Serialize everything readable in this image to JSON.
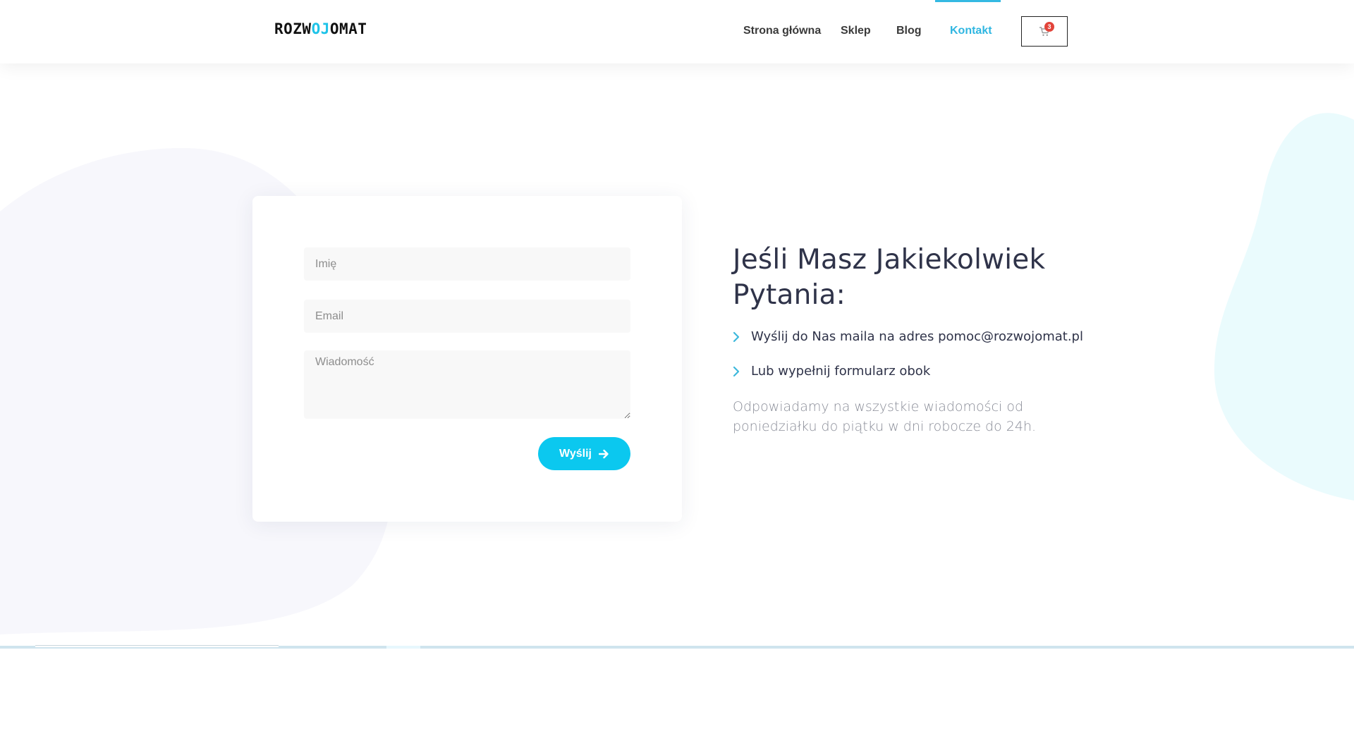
{
  "header": {
    "logo": {
      "part1": "ROZW",
      "accent": "OJ",
      "part2": "OMAT"
    },
    "nav": [
      {
        "label": "Strona główna",
        "active": false
      },
      {
        "label": "Sklep",
        "active": false
      },
      {
        "label": "Blog",
        "active": false
      },
      {
        "label": "Kontakt",
        "active": true
      }
    ],
    "cart": {
      "count": "3",
      "icon": "cart-icon"
    }
  },
  "form": {
    "name_placeholder": "Imię",
    "email_placeholder": "Email",
    "message_placeholder": "Wiadomość",
    "submit_label": "Wyślij",
    "submit_icon": "arrow-right-icon"
  },
  "info": {
    "heading": "Jeśli Masz Jakiekolwiek Pytania:",
    "items": [
      "Wyślij do Nas maila na adres pomoc@rozwojomat.pl",
      "Lub wypełnij formularz obok"
    ],
    "note": "Odpowiadamy na wszystkie wiadomości od poniedziałku do piątku w dni robocze do 24h."
  },
  "colors": {
    "accent": "#0bc8ef",
    "nav_active": "#2fb6e1",
    "heading": "#2f3349",
    "muted": "#8a8d98",
    "badge": "#e2443a"
  }
}
